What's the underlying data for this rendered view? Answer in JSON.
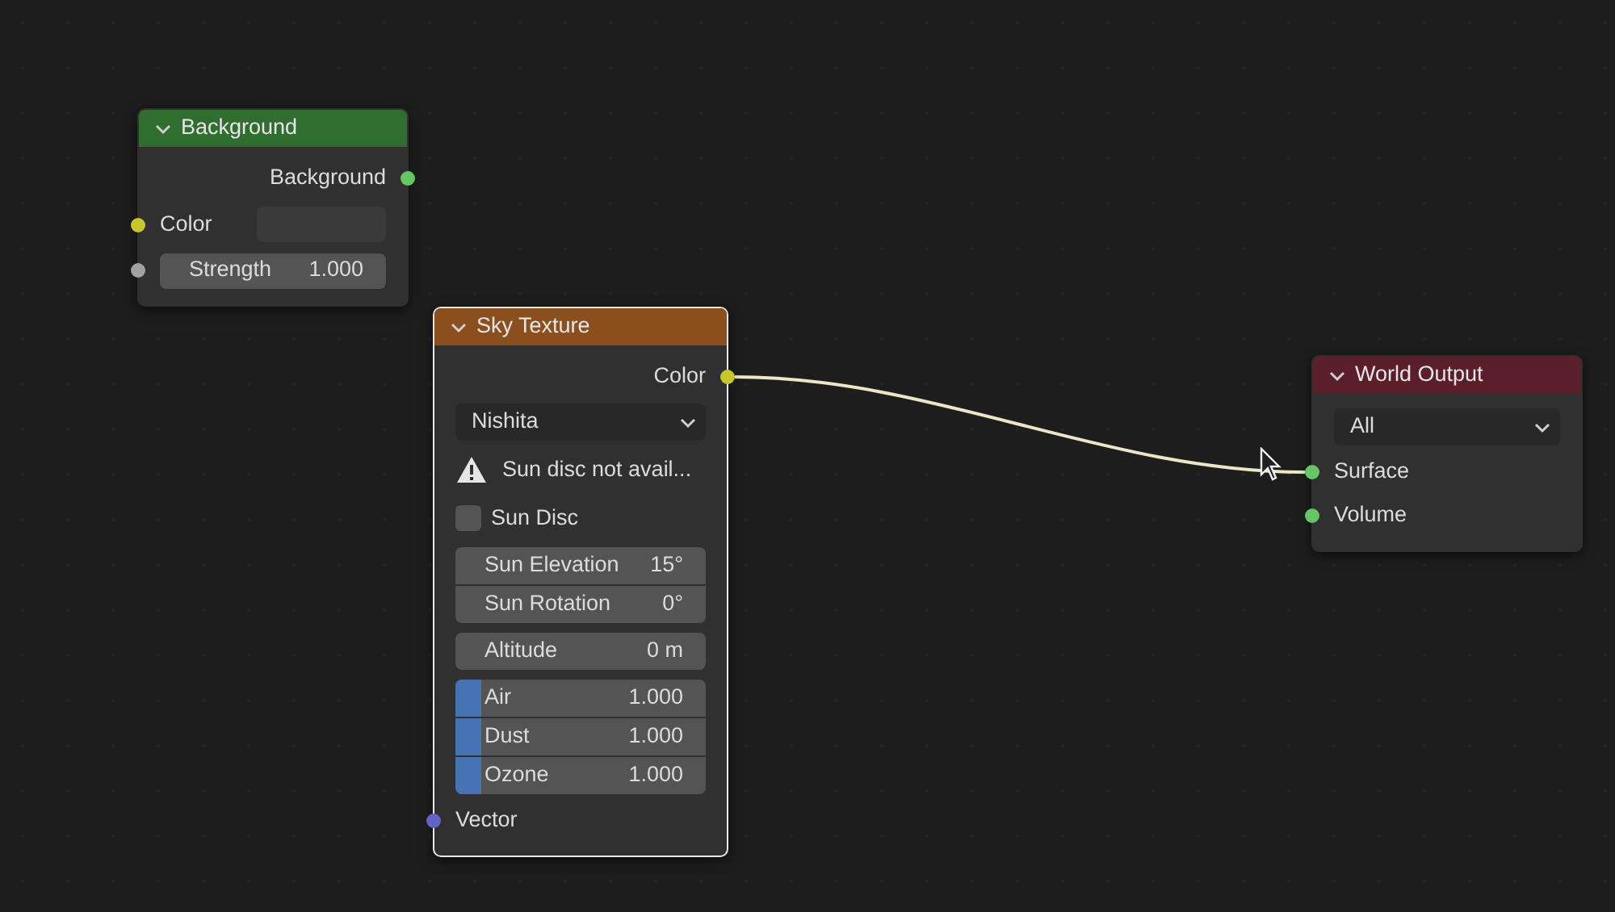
{
  "nodes": [
    {
      "title": "Background",
      "color": "#2f6e2f",
      "selected": false,
      "rows": [
        {
          "kind": "output",
          "label": "Background",
          "color": "#63c763"
        },
        {
          "kind": "color_input",
          "label": "Color",
          "color": "#c7c729"
        },
        {
          "kind": "value_input",
          "label": "Strength",
          "value": "1.000",
          "color": "#a1a1a1"
        }
      ]
    },
    {
      "title": "Sky Texture",
      "color": "#8a4f1c",
      "selected": true,
      "rows": [
        {
          "kind": "output",
          "label": "Color",
          "color": "#c7c729"
        },
        {
          "kind": "dropdown",
          "value": "Nishita"
        },
        {
          "kind": "warning",
          "text": "Sun disc not avail..."
        },
        {
          "kind": "checkbox",
          "label": "Sun Disc",
          "checked": false
        },
        {
          "kind": "value_group",
          "fields": [
            {
              "label": "Sun Elevation",
              "value": "15°"
            },
            {
              "label": "Sun Rotation",
              "value": "0°"
            }
          ]
        },
        {
          "kind": "value_group",
          "fields": [
            {
              "label": "Altitude",
              "value": "0 m"
            }
          ]
        },
        {
          "kind": "factor_group",
          "fields": [
            {
              "label": "Air",
              "value": "1.000",
              "level": 0.1
            },
            {
              "label": "Dust",
              "value": "1.000",
              "level": 0.1
            },
            {
              "label": "Ozone",
              "value": "1.000",
              "level": 0.1
            }
          ]
        },
        {
          "kind": "input",
          "label": "Vector",
          "color": "#6363c7"
        }
      ]
    },
    {
      "title": "World Output",
      "color": "#5a1f2a",
      "selected": false,
      "rows": [
        {
          "kind": "dropdown",
          "value": "All"
        },
        {
          "kind": "input",
          "label": "Surface",
          "color": "#63c763"
        },
        {
          "kind": "input",
          "label": "Volume",
          "color": "#63c763"
        }
      ]
    }
  ]
}
